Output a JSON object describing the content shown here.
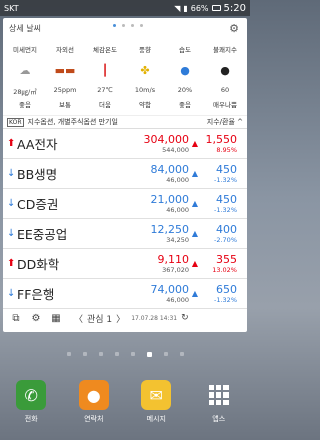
{
  "status_bar": {
    "carrier": "SKT",
    "battery": "66%",
    "time": "5:20"
  },
  "widget": {
    "title": "상세 날씨",
    "gear_icon": "gear-icon",
    "page_dots": 4,
    "active_dot": 1,
    "weather": {
      "labels": [
        "미세먼지",
        "자외선",
        "체감온도",
        "풍향",
        "습도",
        "불쾌지수"
      ],
      "values": [
        "28㎍/㎥",
        "25ppm",
        "27℃",
        "10m/s",
        "20%",
        "60"
      ],
      "status": [
        "좋음",
        "보통",
        "더움",
        "약함",
        "좋음",
        "매우나쁨"
      ],
      "icons": [
        "cloud-icon",
        "sunglasses-icon",
        "thermometer-icon",
        "pinwheel-icon",
        "drop-icon",
        "face-icon"
      ]
    },
    "ticker": {
      "tag": "KOR",
      "text": "지수옵션, 개별주식옵션 만기일",
      "link": "지수/환율 ^"
    },
    "stocks": [
      {
        "name": "AA전자",
        "price": "304,000",
        "volume": "544,000",
        "dir": "up",
        "change": "1,550",
        "rate": "8.95%"
      },
      {
        "name": "BB생명",
        "price": "84,000",
        "volume": "46,000",
        "dir": "up",
        "change": "450",
        "rate": "-1.32%"
      },
      {
        "name": "CD증권",
        "price": "21,000",
        "volume": "46,000",
        "dir": "up",
        "change": "450",
        "rate": "-1.32%"
      },
      {
        "name": "EE중공업",
        "price": "12,250",
        "volume": "34,250",
        "dir": "up",
        "change": "400",
        "rate": "-2.70%"
      },
      {
        "name": "DD화학",
        "price": "9,110",
        "volume": "367,020",
        "dir": "down-red",
        "change": "355",
        "rate": "13.02%"
      },
      {
        "name": "FF은행",
        "price": "74,000",
        "volume": "46,000",
        "dir": "up",
        "change": "650",
        "rate": "-1.32%"
      }
    ],
    "toolbar": {
      "group_label": "관심 1",
      "timestamp": "17.07.28 14:31"
    }
  },
  "dock": {
    "phone": "전화",
    "contacts": "연락처",
    "messages": "메시지",
    "apps": "앱스"
  }
}
